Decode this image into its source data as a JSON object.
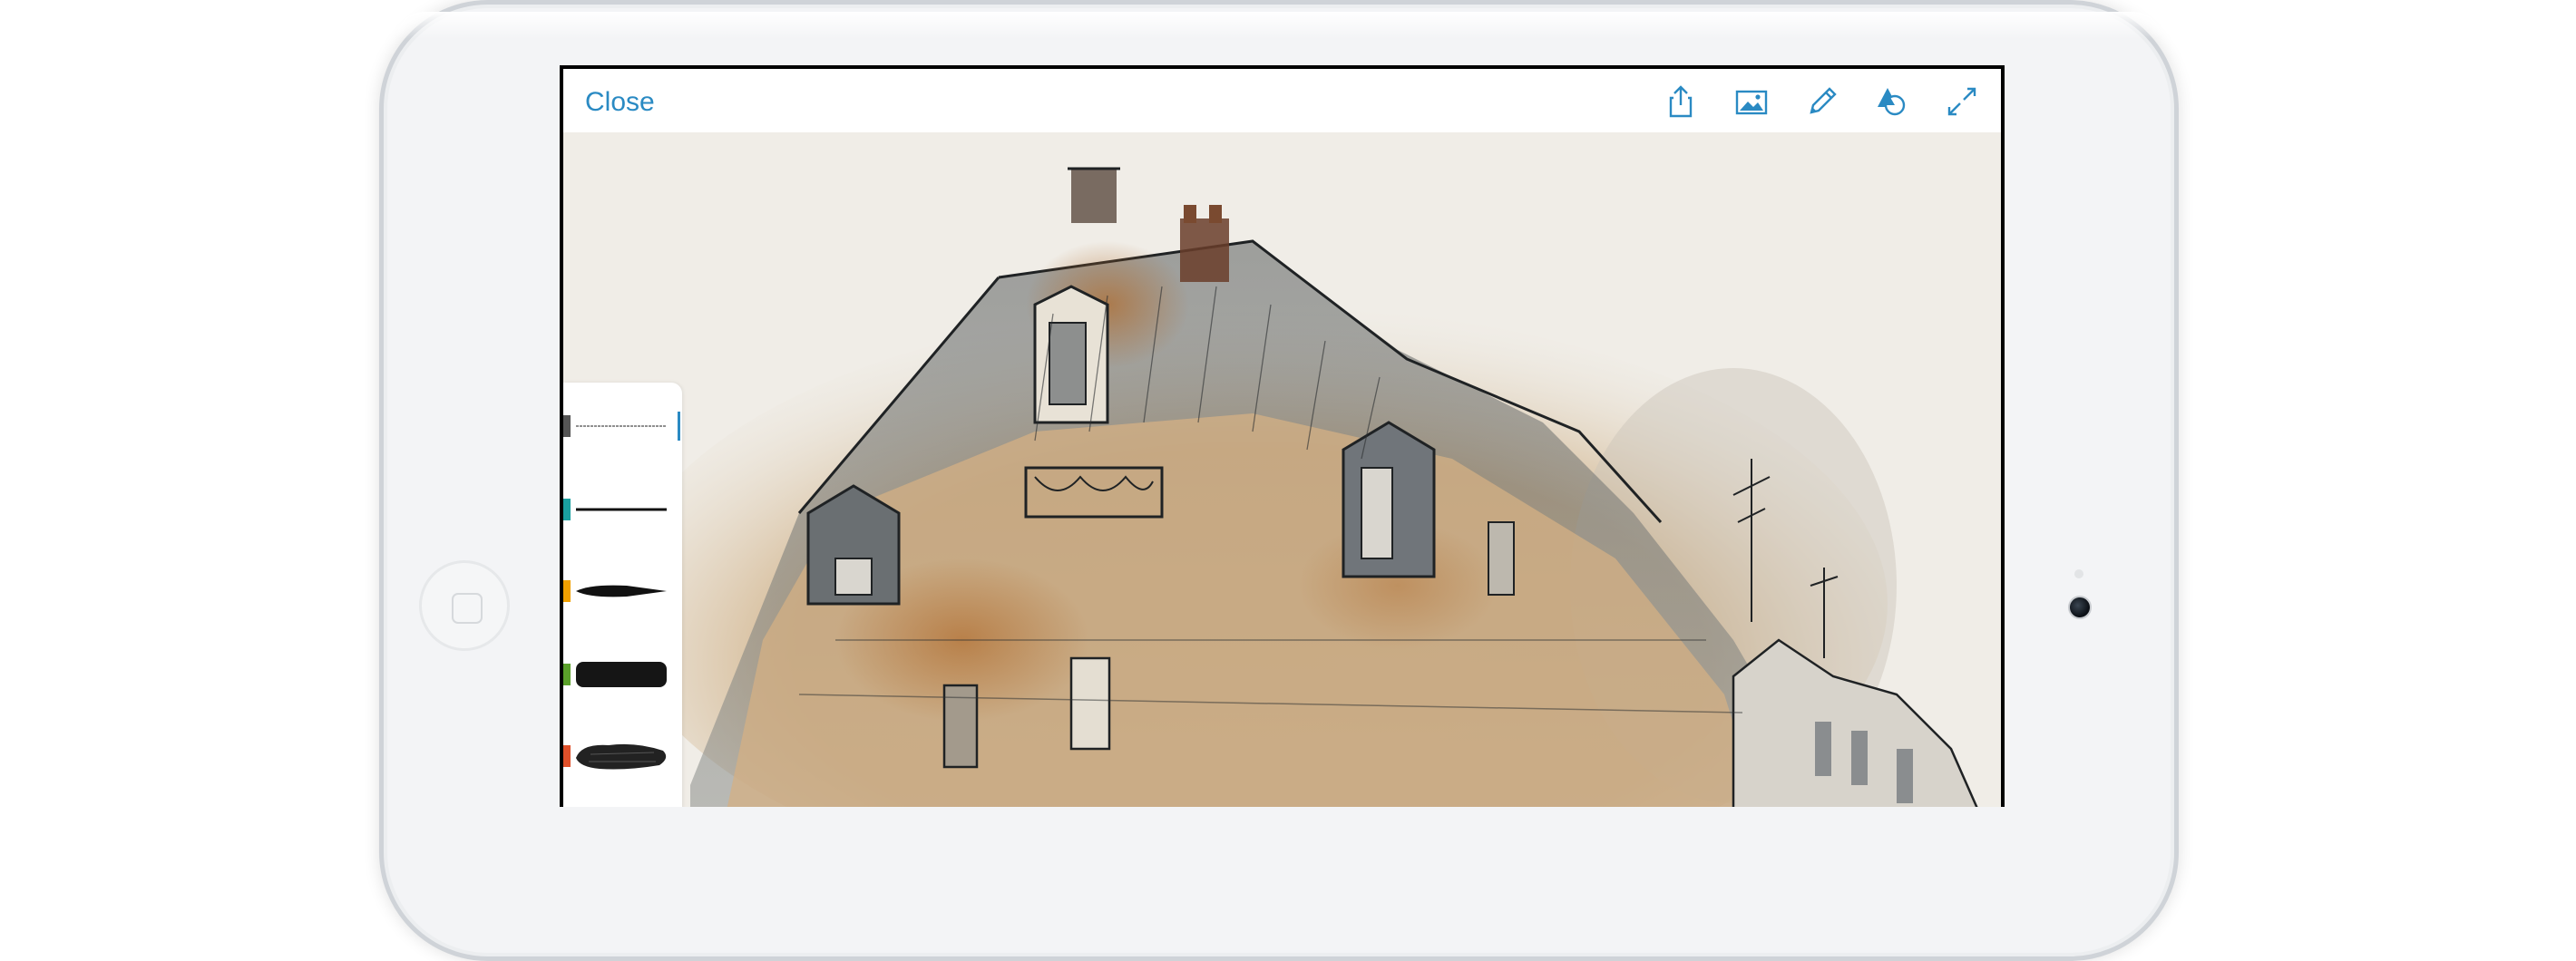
{
  "toolbar": {
    "close_label": "Close",
    "tools": [
      {
        "icon": "share-icon"
      },
      {
        "icon": "image-icon"
      },
      {
        "icon": "pencil-icon"
      },
      {
        "icon": "color-layers-icon"
      },
      {
        "icon": "fullscreen-icon"
      }
    ],
    "accent_color": "#2a8ac3"
  },
  "brushes": [
    {
      "name": "fine-pen",
      "swatch_color": "#555555",
      "selected": true
    },
    {
      "name": "thin-line",
      "swatch_color": "#1aa0a0",
      "selected": false
    },
    {
      "name": "tapered-brush",
      "swatch_color": "#f0a000",
      "selected": false
    },
    {
      "name": "marker",
      "swatch_color": "#5aa02a",
      "selected": false
    },
    {
      "name": "textured-brush",
      "swatch_color": "#e0502a",
      "selected": false
    }
  ],
  "artwork": {
    "subject": "watercolor-and-ink-building"
  }
}
